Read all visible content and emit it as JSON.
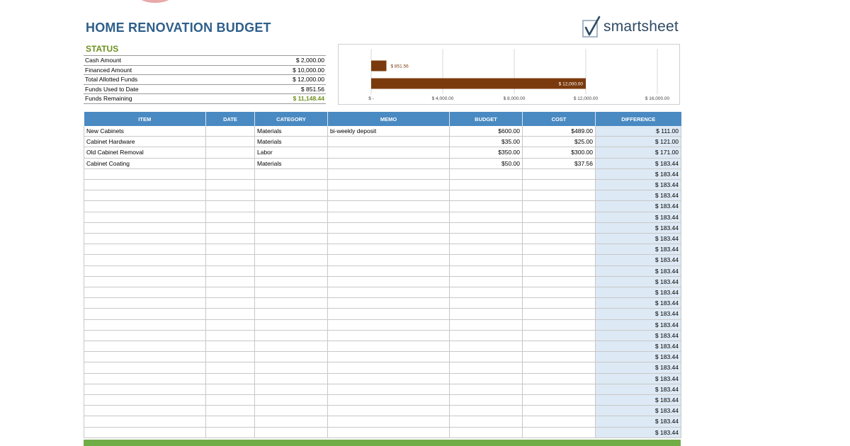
{
  "header": {
    "title": "HOME RENOVATION BUDGET",
    "logo_text": "smartsheet"
  },
  "status": {
    "title": "STATUS",
    "rows": [
      {
        "label": "Cash Amount",
        "value": "$ 2,000.00"
      },
      {
        "label": "Financed Amount",
        "value": "$ 10,000.00"
      },
      {
        "label": "Total Allotted Funds",
        "value": "$ 12,000.00"
      },
      {
        "label": "Funds Used to Date",
        "value": "$ 851.56"
      },
      {
        "label": "Funds Remaining",
        "value": "$ 11,148.44"
      }
    ]
  },
  "chart_data": {
    "type": "bar",
    "orientation": "horizontal",
    "categories": [
      "Funds Used to Date",
      "Total Allotted Funds"
    ],
    "values": [
      851.56,
      12000
    ],
    "data_labels": [
      "$ 851.56",
      "$ 12,000.00"
    ],
    "xlim": [
      0,
      16000
    ],
    "x_ticks": [
      0,
      4000,
      8000,
      12000,
      16000
    ],
    "x_tick_labels": [
      "$ -",
      "$ 4,000.00",
      "$ 8,000.00",
      "$ 12,000.00",
      "$ 16,000.00"
    ],
    "bar_color": "#7b3a0e",
    "grid": true
  },
  "table": {
    "headers": {
      "item": "ITEM",
      "date": "DATE",
      "category": "CATEGORY",
      "memo": "MEMO",
      "budget": "BUDGET",
      "cost": "COST",
      "difference": "DIFFERENCE"
    },
    "rows": [
      {
        "item": "New Cabinets",
        "date": "",
        "category": "Materials",
        "memo": "bi-weekly deposit",
        "budget": "$600.00",
        "cost": "$489.00",
        "difference": "$ 111.00"
      },
      {
        "item": "Cabinet Hardware",
        "date": "",
        "category": "Materials",
        "memo": "",
        "budget": "$35.00",
        "cost": "$25.00",
        "difference": "$ 121.00"
      },
      {
        "item": "Old Cabinet Removal",
        "date": "",
        "category": "Labor",
        "memo": "",
        "budget": "$350.00",
        "cost": "$300.00",
        "difference": "$ 171.00"
      },
      {
        "item": "Cabinet Coating",
        "date": "",
        "category": "Materials",
        "memo": "",
        "budget": "$50.00",
        "cost": "$37.56",
        "difference": "$ 183.44"
      },
      {
        "item": "",
        "date": "",
        "category": "",
        "memo": "",
        "budget": "",
        "cost": "",
        "difference": "$ 183.44"
      },
      {
        "item": "",
        "date": "",
        "category": "",
        "memo": "",
        "budget": "",
        "cost": "",
        "difference": "$ 183.44"
      },
      {
        "item": "",
        "date": "",
        "category": "",
        "memo": "",
        "budget": "",
        "cost": "",
        "difference": "$ 183.44"
      },
      {
        "item": "",
        "date": "",
        "category": "",
        "memo": "",
        "budget": "",
        "cost": "",
        "difference": "$ 183.44"
      },
      {
        "item": "",
        "date": "",
        "category": "",
        "memo": "",
        "budget": "",
        "cost": "",
        "difference": "$ 183.44"
      },
      {
        "item": "",
        "date": "",
        "category": "",
        "memo": "",
        "budget": "",
        "cost": "",
        "difference": "$ 183.44"
      },
      {
        "item": "",
        "date": "",
        "category": "",
        "memo": "",
        "budget": "",
        "cost": "",
        "difference": "$ 183.44"
      },
      {
        "item": "",
        "date": "",
        "category": "",
        "memo": "",
        "budget": "",
        "cost": "",
        "difference": "$ 183.44"
      },
      {
        "item": "",
        "date": "",
        "category": "",
        "memo": "",
        "budget": "",
        "cost": "",
        "difference": "$ 183.44"
      },
      {
        "item": "",
        "date": "",
        "category": "",
        "memo": "",
        "budget": "",
        "cost": "",
        "difference": "$ 183.44"
      },
      {
        "item": "",
        "date": "",
        "category": "",
        "memo": "",
        "budget": "",
        "cost": "",
        "difference": "$ 183.44"
      },
      {
        "item": "",
        "date": "",
        "category": "",
        "memo": "",
        "budget": "",
        "cost": "",
        "difference": "$ 183.44"
      },
      {
        "item": "",
        "date": "",
        "category": "",
        "memo": "",
        "budget": "",
        "cost": "",
        "difference": "$ 183.44"
      },
      {
        "item": "",
        "date": "",
        "category": "",
        "memo": "",
        "budget": "",
        "cost": "",
        "difference": "$ 183.44"
      },
      {
        "item": "",
        "date": "",
        "category": "",
        "memo": "",
        "budget": "",
        "cost": "",
        "difference": "$ 183.44"
      },
      {
        "item": "",
        "date": "",
        "category": "",
        "memo": "",
        "budget": "",
        "cost": "",
        "difference": "$ 183.44"
      },
      {
        "item": "",
        "date": "",
        "category": "",
        "memo": "",
        "budget": "",
        "cost": "",
        "difference": "$ 183.44"
      },
      {
        "item": "",
        "date": "",
        "category": "",
        "memo": "",
        "budget": "",
        "cost": "",
        "difference": "$ 183.44"
      },
      {
        "item": "",
        "date": "",
        "category": "",
        "memo": "",
        "budget": "",
        "cost": "",
        "difference": "$ 183.44"
      },
      {
        "item": "",
        "date": "",
        "category": "",
        "memo": "",
        "budget": "",
        "cost": "",
        "difference": "$ 183.44"
      },
      {
        "item": "",
        "date": "",
        "category": "",
        "memo": "",
        "budget": "",
        "cost": "",
        "difference": "$ 183.44"
      },
      {
        "item": "",
        "date": "",
        "category": "",
        "memo": "",
        "budget": "",
        "cost": "",
        "difference": "$ 183.44"
      },
      {
        "item": "",
        "date": "",
        "category": "",
        "memo": "",
        "budget": "",
        "cost": "",
        "difference": "$ 183.44"
      },
      {
        "item": "",
        "date": "",
        "category": "",
        "memo": "",
        "budget": "",
        "cost": "",
        "difference": "$ 183.44"
      },
      {
        "item": "",
        "date": "",
        "category": "",
        "memo": "",
        "budget": "",
        "cost": "",
        "difference": "$ 183.44"
      }
    ]
  },
  "colors": {
    "title": "#2e5f8a",
    "status_accent": "#6e8f1e",
    "header_blue": "#4a8ac2",
    "difference_fill": "#dde9f4",
    "footer_green": "#70ad47"
  }
}
